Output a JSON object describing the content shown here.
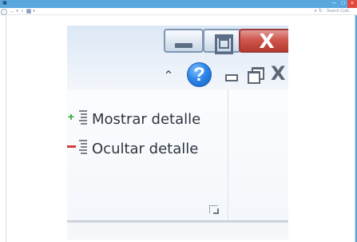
{
  "outer_window": {
    "minimize_glyph": "–",
    "maximize_glyph": "□",
    "close_glyph": "×"
  },
  "navbar": {
    "back_glyph": "←",
    "forward_glyph": "→",
    "dropdown_glyph": "▾",
    "up_glyph": "↑",
    "folder_glyph": "▦",
    "refresh_glyph": "↻",
    "search_placeholder": "Search Cont..."
  },
  "magnified_window": {
    "minimize_icon": "minimize-icon",
    "maximize_icon": "maximize-icon",
    "close_label": "X"
  },
  "ribbon": {
    "collapse_glyph": "⌃",
    "help_glyph": "?",
    "mdi_close_glyph": "X"
  },
  "commands": {
    "show_detail": "Mostrar detalle",
    "hide_detail": "Ocultar detalle"
  },
  "colors": {
    "window_frame": "#5aa7de",
    "close_red": "#cf574e",
    "help_blue": "#2e86e7",
    "plus_green": "#2da52b",
    "minus_red": "#d53f38"
  }
}
